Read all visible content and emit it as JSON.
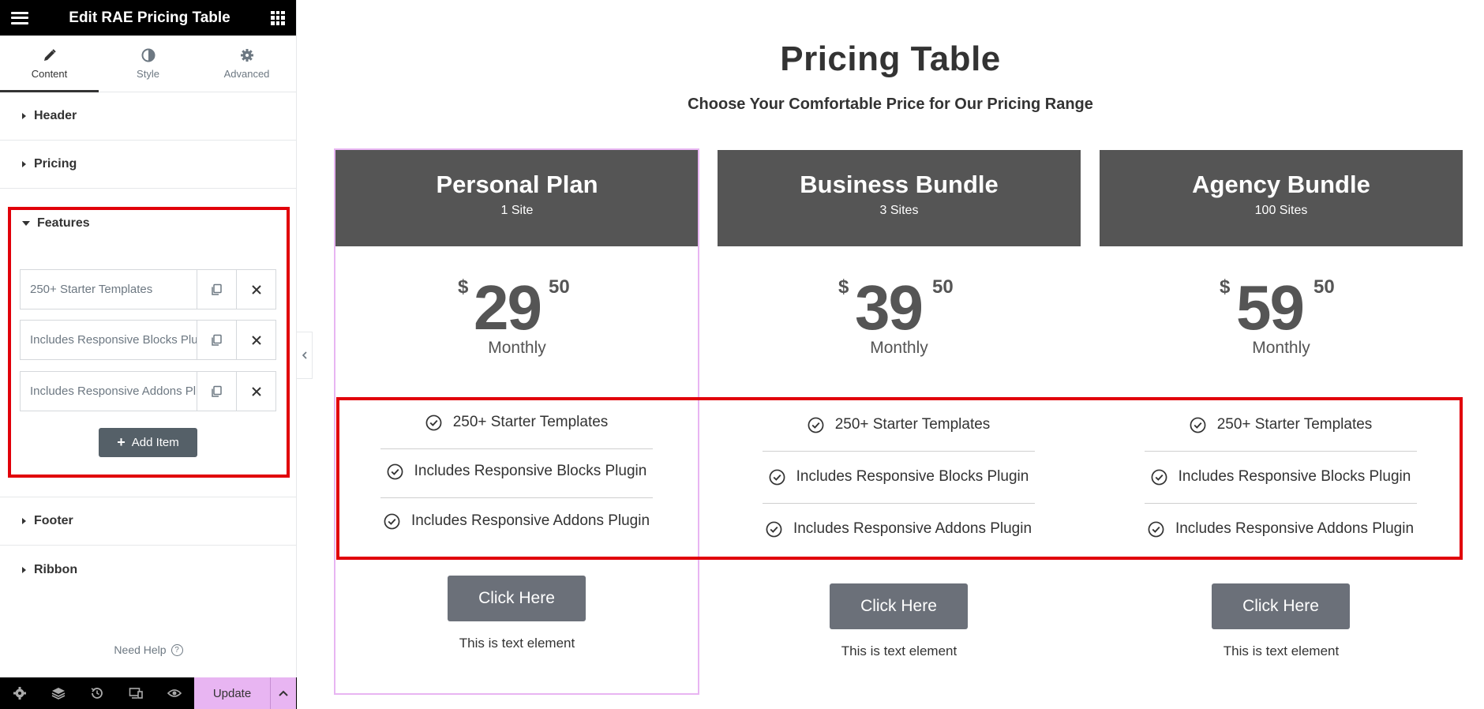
{
  "editor": {
    "title": "Edit RAE Pricing Table",
    "tabs": [
      {
        "label": "Content",
        "icon": "pencil-icon"
      },
      {
        "label": "Style",
        "icon": "half-circle-icon"
      },
      {
        "label": "Advanced",
        "icon": "gear-icon"
      }
    ],
    "sections": {
      "header": "Header",
      "pricing": "Pricing",
      "features": "Features",
      "footer": "Footer",
      "ribbon": "Ribbon"
    },
    "feature_items": [
      "250+ Starter Templates",
      "Includes Responsive Blocks Plugin",
      "Includes Responsive Addons Plugin"
    ],
    "add_item_label": "Add Item",
    "need_help": "Need Help",
    "update_label": "Update",
    "accent_color": "#e8b5f2",
    "highlight_color": "#e1000a"
  },
  "preview": {
    "title": "Pricing Table",
    "subtitle": "Choose Your Comfortable Price for Our Pricing Range",
    "plans": [
      {
        "name": "Personal Plan",
        "sites": "1 Site",
        "currency": "$",
        "price": "29",
        "cents": "50",
        "period": "Monthly",
        "features": [
          "250+ Starter Templates",
          "Includes Responsive Blocks Plugin",
          "Includes Responsive Addons Plugin"
        ],
        "button": "Click Here",
        "note": "This is text element"
      },
      {
        "name": "Business Bundle",
        "sites": "3 Sites",
        "currency": "$",
        "price": "39",
        "cents": "50",
        "period": "Monthly",
        "features": [
          "250+ Starter Templates",
          "Includes Responsive Blocks Plugin",
          "Includes Responsive Addons Plugin"
        ],
        "button": "Click Here",
        "note": "This is text element"
      },
      {
        "name": "Agency Bundle",
        "sites": "100 Sites",
        "currency": "$",
        "price": "59",
        "cents": "50",
        "period": "Monthly",
        "features": [
          "250+ Starter Templates",
          "Includes Responsive Blocks Plugin",
          "Includes Responsive Addons Plugin"
        ],
        "button": "Click Here",
        "note": "This is text element"
      }
    ],
    "header_color": "#555555",
    "button_color": "#6b7079"
  }
}
